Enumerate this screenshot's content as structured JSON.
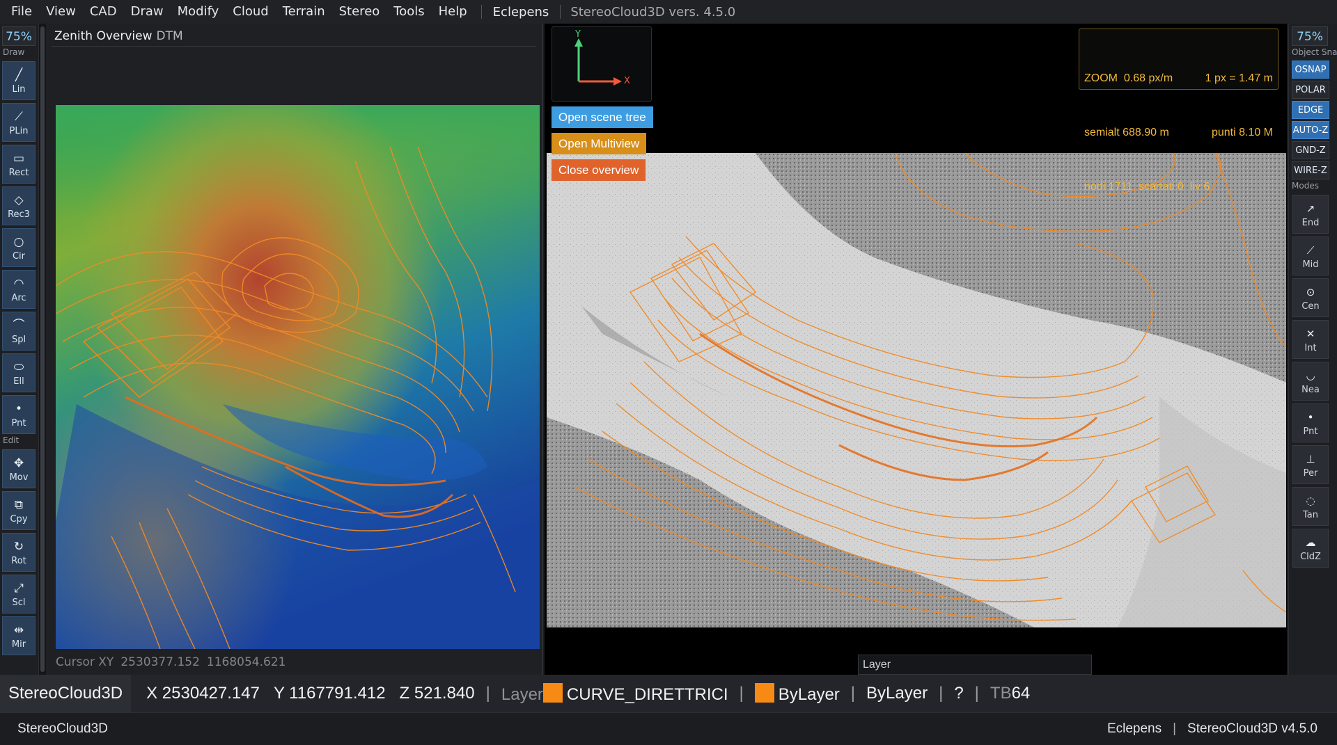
{
  "menubar": {
    "items": [
      "File",
      "View",
      "CAD",
      "Draw",
      "Modify",
      "Cloud",
      "Terrain",
      "Stereo",
      "Tools",
      "Help"
    ],
    "brand": "Eclepens",
    "version": "StereoCloud3D vers. 4.5.0"
  },
  "left_toolbar": {
    "zoom": "75%",
    "draw_label": "Draw",
    "draw_tools": [
      {
        "label": "Lin",
        "icon": "line-icon"
      },
      {
        "label": "PLin",
        "icon": "polyline-icon"
      },
      {
        "label": "Rect",
        "icon": "rectangle-icon"
      },
      {
        "label": "Rec3",
        "icon": "rect3-icon"
      },
      {
        "label": "Cir",
        "icon": "circle-icon"
      },
      {
        "label": "Arc",
        "icon": "arc-icon"
      },
      {
        "label": "Spl",
        "icon": "spline-icon"
      },
      {
        "label": "Ell",
        "icon": "ellipse-icon"
      },
      {
        "label": "Pnt",
        "icon": "point-icon"
      }
    ],
    "edit_label": "Edit",
    "edit_tools": [
      {
        "label": "Mov",
        "icon": "move-icon"
      },
      {
        "label": "Cpy",
        "icon": "copy-icon"
      },
      {
        "label": "Rot",
        "icon": "rotate-icon"
      },
      {
        "label": "Scl",
        "icon": "scale-icon"
      },
      {
        "label": "Mir",
        "icon": "mirror-icon"
      }
    ]
  },
  "right_toolbar": {
    "zoom": "75%",
    "snap_label": "Object Snap",
    "snaps": [
      {
        "label": "OSNAP",
        "on": true
      },
      {
        "label": "POLAR",
        "on": false
      },
      {
        "label": "EDGE",
        "on": true
      },
      {
        "label": "AUTO-Z",
        "on": true
      },
      {
        "label": "GND-Z",
        "on": false
      },
      {
        "label": "WIRE-Z",
        "on": false
      }
    ],
    "modes_label": "Modes",
    "modes": [
      {
        "label": "End",
        "icon": "endpoint-icon"
      },
      {
        "label": "Mid",
        "icon": "midpoint-icon"
      },
      {
        "label": "Cen",
        "icon": "center-icon"
      },
      {
        "label": "Int",
        "icon": "intersection-icon"
      },
      {
        "label": "Nea",
        "icon": "nearest-icon"
      },
      {
        "label": "Pnt",
        "icon": "point-snap-icon"
      },
      {
        "label": "Per",
        "icon": "perpendicular-icon"
      },
      {
        "label": "Tan",
        "icon": "tangent-icon"
      },
      {
        "label": "CldZ",
        "icon": "cloud-z-icon"
      }
    ]
  },
  "overview": {
    "title": "Zenith Overview",
    "subtitle": "DTM",
    "cursor_label": "Cursor XY",
    "cursor_x": "2530377.152",
    "cursor_y": "1168054.621"
  },
  "stereo": {
    "axis_y": "Y",
    "axis_x": "X",
    "btn_scene_tree": "Open scene tree",
    "btn_multiview": "Open Multiview",
    "btn_close_overview": "Close overview",
    "zoom_line1_a": "ZOOM  0.68 px/m",
    "zoom_line1_b": "1 px = 1.47 m",
    "zoom_line2_a": "semialt 688.90 m",
    "zoom_line2_b": "punti 8.10 M",
    "zoom_line3": "nodi 1711  scartati 0  liv 6",
    "layer_placeholder": "Layer"
  },
  "statusbar": {
    "app": "StereoCloud3D",
    "x": "X 2530427.147",
    "y": "Y 1167791.412",
    "z": "Z 521.840",
    "layer_label": "Layer",
    "layer_name": "CURVE_DIRETTRICI",
    "color_name": "ByLayer",
    "linetype": "ByLayer",
    "help": "?",
    "tb_prefix": "TB",
    "tb_value": "64",
    "swatch_color": "#f78a14"
  },
  "bottombar": {
    "left": "StereoCloud3D",
    "right_a": "Eclepens",
    "right_b": "StereoCloud3D v4.5.0"
  }
}
